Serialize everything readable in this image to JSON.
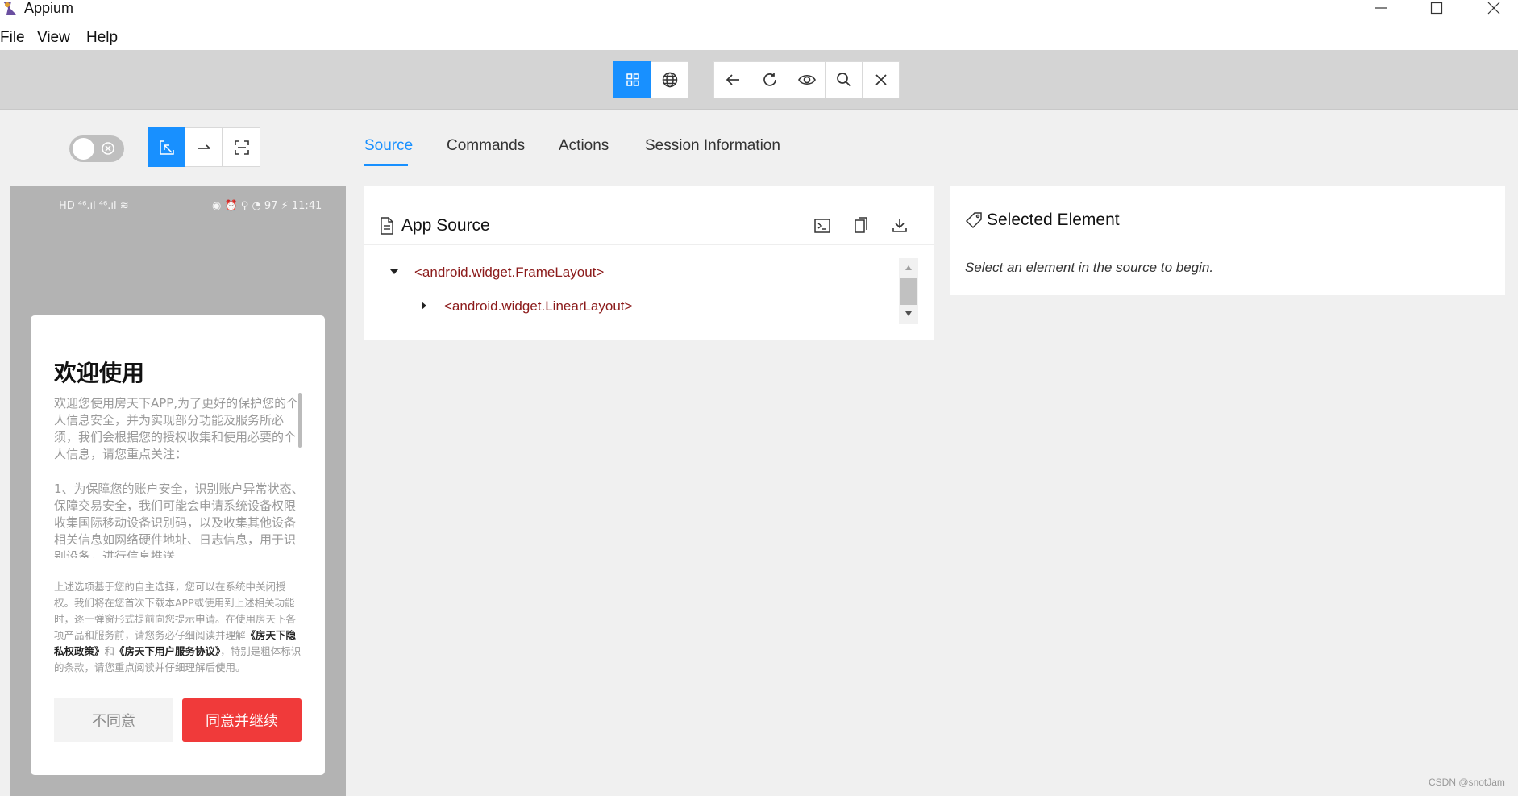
{
  "window": {
    "title": "Appium",
    "controls": [
      "minimize",
      "maximize",
      "close"
    ]
  },
  "menu": {
    "items": [
      "File",
      "View",
      "Help"
    ]
  },
  "toolbar": {
    "view_group": [
      "grid-icon",
      "globe-icon"
    ],
    "active_view": "grid-icon",
    "action_group": [
      "arrow-left-icon",
      "refresh-icon",
      "eye-icon",
      "search-icon",
      "close-icon"
    ]
  },
  "left_controls": {
    "toggle_on": false,
    "mode_buttons": [
      "select-icon",
      "swipe-icon",
      "tap-coordinates-icon"
    ],
    "active_mode": "select-icon"
  },
  "device": {
    "status_left": "HD ⁴⁶.ıl ⁴⁶.ıl ≋",
    "status_right": "◉ ⏰ ⚲ ◔ 97 ⚡ 11:41",
    "dialog": {
      "title": "欢迎使用",
      "paragraph1": "欢迎您使用房天下APP,为了更好的保护您的个人信息安全，并为实现部分功能及服务所必须，我们会根据您的授权收集和使用必要的个人信息，请您重点关注：",
      "paragraph2": "1、为保障您的账户安全，识别账户异常状态、保障交易安全，我们可能会申请系统设备权限收集国际移动设备识别码，以及收集其他设备相关信息如网络硬件地址、日志信息，用于识别设备，进行信息推送",
      "paragraph3_a": "上述选项基于您的自主选择，您可以在系统中关闭授权。我们将在您首次下载本APP或使用到上述相关功能时，逐一弹窗形式提前向您提示申请。在使用房天下各项产品和服务前，请您务必仔细阅读并理解",
      "paragraph3_link1": "《房天下隐私权政策》",
      "paragraph3_and": "和",
      "paragraph3_link2": "《房天下用户服务协议》",
      "paragraph3_b": "，特别是粗体标识的条款，请您重点阅读并仔细理解后使用。",
      "disagree": "不同意",
      "agree": "同意并继续"
    }
  },
  "tabs": [
    "Source",
    "Commands",
    "Actions",
    "Session Information"
  ],
  "active_tab": "Source",
  "source_panel": {
    "title": "App Source",
    "actions": [
      "terminal-icon",
      "copy-icon",
      "download-icon"
    ],
    "tree": [
      {
        "label": "<android.widget.FrameLayout>",
        "expanded": true,
        "depth": 0
      },
      {
        "label": "<android.widget.LinearLayout>",
        "expanded": false,
        "depth": 1
      }
    ]
  },
  "selected_panel": {
    "title": "Selected Element",
    "hint": "Select an element in the source to begin."
  },
  "watermark": "CSDN @snotJam",
  "colors": {
    "accent": "#1890ff",
    "agree_button": "#f03a3a",
    "tree_text": "#8b1a1a"
  }
}
